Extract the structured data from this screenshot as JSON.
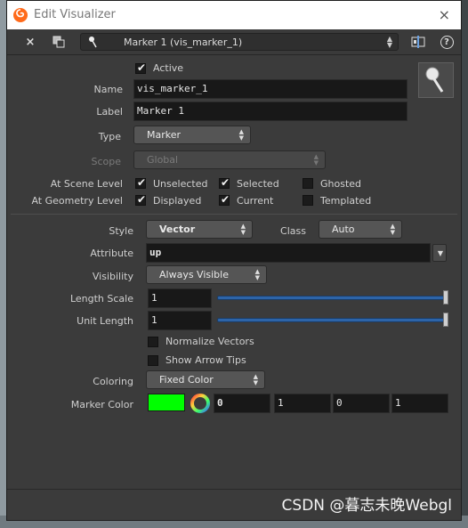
{
  "window": {
    "title": "Edit Visualizer",
    "close_glyph": "×"
  },
  "toolbar": {
    "close_glyph": "×",
    "selected_visualizer": "Marker 1 (vis_marker_1)",
    "help_glyph": "?"
  },
  "form": {
    "active_label": "Active",
    "name_label": "Name",
    "name_value": "vis_marker_1",
    "label_label": "Label",
    "label_value": "Marker 1",
    "type_label": "Type",
    "type_value": "Marker",
    "scope_label": "Scope",
    "scope_value": "Global",
    "at_scene_level_label": "At Scene Level",
    "at_geometry_level_label": "At Geometry Level",
    "unselected_label": "Unselected",
    "selected_label": "Selected",
    "ghosted_label": "Ghosted",
    "displayed_label": "Displayed",
    "current_label": "Current",
    "templated_label": "Templated",
    "style_label": "Style",
    "style_value": "Vector",
    "class_label": "Class",
    "class_value": "Auto",
    "attribute_label": "Attribute",
    "attribute_value": "up",
    "visibility_label": "Visibility",
    "visibility_value": "Always Visible",
    "length_scale_label": "Length Scale",
    "length_scale_value": "1",
    "unit_length_label": "Unit Length",
    "unit_length_value": "1",
    "normalize_vectors_label": "Normalize Vectors",
    "show_arrow_tips_label": "Show Arrow Tips",
    "coloring_label": "Coloring",
    "coloring_value": "Fixed Color",
    "marker_color_label": "Marker Color",
    "marker_color_hex": "#00ff00",
    "marker_color_r": "0",
    "marker_color_g": "1",
    "marker_color_b": "0",
    "marker_color_a": "1"
  },
  "checkbox_states": {
    "active": true,
    "scene_unselected": true,
    "scene_selected": true,
    "scene_ghosted": false,
    "geo_displayed": true,
    "geo_current": true,
    "geo_templated": false,
    "normalize_vectors": false,
    "show_arrow_tips": false
  },
  "slider_levels": {
    "length_scale": 1.0,
    "unit_length": 1.0
  },
  "watermark": "CSDN @暮志未晚Webgl"
}
